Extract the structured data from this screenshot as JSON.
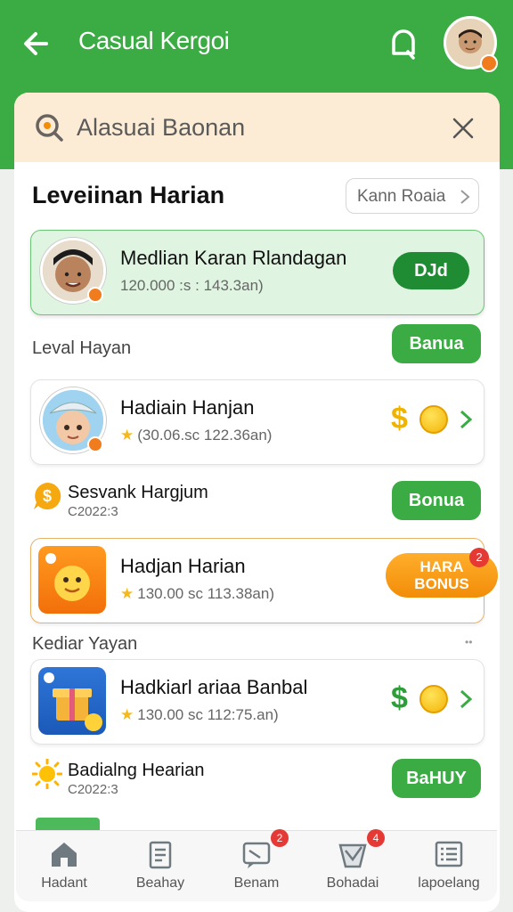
{
  "header": {
    "title": "Casual Kergoi"
  },
  "search": {
    "placeholder": "Alasuai Baonan"
  },
  "section": {
    "title": "Leveiinan Harian",
    "filter_label": "Kann Roaia"
  },
  "highlight_row": {
    "title": "Medlian Karan Rlandagan",
    "subtitle": "120.000 :s : 143.3an)",
    "button": "DJd"
  },
  "group1": {
    "heading": "Leval Hayan",
    "button": "Banua"
  },
  "row1": {
    "title": "Hadiain Hanjan",
    "subtitle": "(30.06.sc 122.36an)"
  },
  "plain1": {
    "title": "Sesvank Hargjum",
    "code": "C2022:3",
    "button": "Bonua"
  },
  "row2": {
    "title": "Hadjan Harian",
    "subtitle": "130.00 sc 113.38an)",
    "bonus_line1": "HARA",
    "bonus_line2": "BONUS",
    "badge": "2"
  },
  "group2": {
    "heading": "Kediar Yayan",
    "mark": "••"
  },
  "row3": {
    "title": "Hadkiarl ariaa Banbal",
    "subtitle": "130.00 sc 112:75.an)"
  },
  "plain2": {
    "title": "Badialng Hearian",
    "code": "C2022:3",
    "button": "BaHUY"
  },
  "tabs": [
    {
      "label": "Hadant",
      "icon": "home-icon"
    },
    {
      "label": "Beahay",
      "icon": "document-icon"
    },
    {
      "label": "Benam",
      "icon": "chat-icon",
      "badge": "2"
    },
    {
      "label": "Bohadai",
      "icon": "inbox-icon",
      "badge": "4"
    },
    {
      "label": "lapoelang",
      "icon": "list-icon"
    }
  ],
  "colors": {
    "primary_green": "#3bab43",
    "dark_green": "#1f8b33",
    "orange": "#f28d08",
    "search_bg": "#fcecd6",
    "highlight_bg": "#dff5e1"
  }
}
